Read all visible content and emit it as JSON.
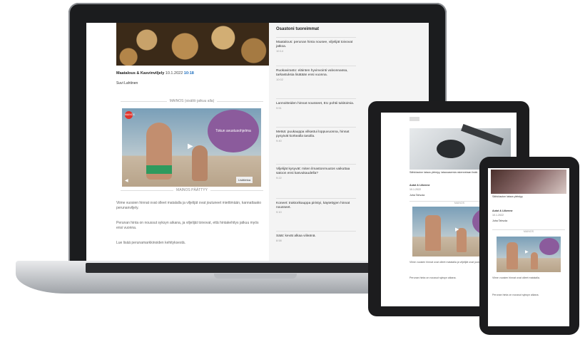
{
  "laptop": {
    "article": {
      "meta_section": "Maatalous & Kasvinviljely",
      "meta_date": "10.1.2022",
      "meta_link": "10:18",
      "author": "Suvi Lahtinen",
      "ad_label_top": "MAINOS (sisältö jatkuu alla)",
      "video_overlay": "Tokun avustusohjelma",
      "video_logo": "MAINOS",
      "video_control": "Lisätietoa",
      "ad_label_bottom": "MAINOS PÄÄTTYY",
      "paragraphs": [
        "Viime vuosien hinnat ovat olleet matalalla ja viljelijät ovat joutuneet miettimään, kannattaako perunanviljely.",
        "Perunan hinta on noussut syksyn aikana, ja viljelijät toivovat, että hintakehitys jatkuu myös ensi vuonna.",
        "Lue lisää perunamarkkinoiden kehityksestä."
      ]
    },
    "sidebar": {
      "heading": "Osastoni tuoreimmat",
      "items": [
        {
          "title": "Maatalous: perunan hinta nousee, viljelijät toivovat jatkoa.",
          "date": "10:14"
        },
        {
          "title": "Ruokavirasto: eläinten hyvinvointi valvonnassa, tarkastuksia lisätään ensi vuonna.",
          "date": "10:02"
        },
        {
          "title": "Lannoitteiden hinnat nousseet, EU pohtii tukitoimia.",
          "date": "9:51"
        },
        {
          "title": "Metsä: puukauppa vilkastui loppuvuonna, hinnat pysyivät korkealla tasolla.",
          "date": "9:40"
        },
        {
          "title": "Viljelijät kysyvät: miten ilmastonmuutos vaikuttaa satoon ensi kasvukaudella?",
          "date": "9:22"
        },
        {
          "title": "Koneet: traktorikauppa piristyi, käytettyjen hinnat nousseet.",
          "date": "9:10"
        },
        {
          "title": "Säät: kevät alkaa viileänä.",
          "date": "8:58"
        }
      ]
    }
  },
  "tablet": {
    "caption": "Sähköauton lataus yleistyy, latausasemia rakennetaan lisää.",
    "section": "Autot & Liikenne",
    "date": "10.1.2022",
    "author": "Juha Tahvola",
    "ad_label": "MAINOS",
    "paragraphs": [
      "Viime vuosien hinnat ovat olleet matalalla ja viljelijät ovat joutuneet miettimään.",
      "Perunan hinta on noussut syksyn aikana."
    ]
  },
  "phone": {
    "caption": "Sähköauton lataus yleistyy.",
    "section": "Autot & Liikenne",
    "date": "10.1.2022",
    "author": "Juha Tahvola",
    "ad_label": "MAINOS",
    "paragraphs": [
      "Viime vuosien hinnat ovat olleet matalalla.",
      "Perunan hinta on noussut syksyn aikana."
    ]
  },
  "colors": {
    "frame": "#1c1c1e",
    "accent_purple": "#8b5b9c",
    "link_blue": "#1f6fbf",
    "shorts_green": "#2f9a5e"
  }
}
